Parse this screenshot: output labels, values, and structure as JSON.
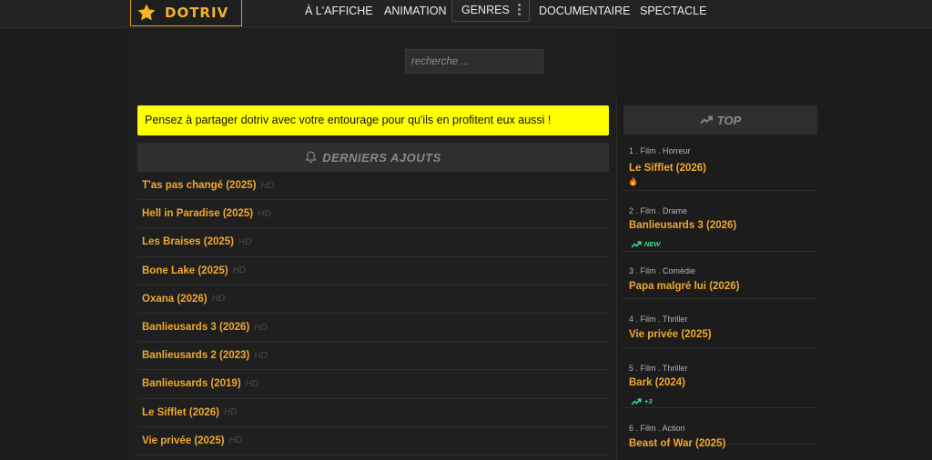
{
  "brand": {
    "name": "DOTRIV"
  },
  "nav": {
    "items": [
      "À L'AFFICHE",
      "ANIMATION",
      "DOCUMENTAIRE",
      "SPECTACLE"
    ],
    "genres_label": "GENRES"
  },
  "search": {
    "placeholder": "recherche ..."
  },
  "notice": {
    "text": "Pensez à partager dotriv avec votre entourage pour qu'ils en profitent eux aussi !"
  },
  "latest": {
    "header": "DERNIERS AJOUTS",
    "hd_label": "HD",
    "items": [
      "T'as pas changé (2025)",
      "Hell in Paradise (2025)",
      "Les Braises (2025)",
      "Bone Lake (2025)",
      "Oxana (2026)",
      "Banlieusards 3 (2026)",
      "Banlieusards 2 (2023)",
      "Banlieusards (2019)",
      "Le Sifflet (2026)",
      "Vie privée (2025)"
    ]
  },
  "top": {
    "header": "TOP",
    "items": [
      {
        "meta": "1 . Film . Horreur",
        "title": "Le Sifflet (2026)",
        "badge_type": "fire",
        "badge": ""
      },
      {
        "meta": "2 . Film . Drame",
        "title": "Banlieusards 3 (2026)",
        "badge_type": "trend",
        "badge": "NEW"
      },
      {
        "meta": "3 . Film . Comédie",
        "title": "Papa malgré lui (2026)",
        "badge_type": "none",
        "badge": ""
      },
      {
        "meta": "4 . Film . Thriller",
        "title": "Vie privée (2025)",
        "badge_type": "none",
        "badge": ""
      },
      {
        "meta": "5 . Film . Thriller",
        "title": "Bark (2024)",
        "badge_type": "trend",
        "badge": "+3"
      },
      {
        "meta": "6 . Film . Action",
        "title": "Beast of War (2025)",
        "badge_type": "none",
        "badge": ""
      }
    ]
  },
  "colors": {
    "accent": "#f0a830",
    "notice_bg": "#ffff00",
    "trend_green": "#3ddc84",
    "background": "#1c1c1c"
  },
  "icons": {
    "logo": "star-icon",
    "genres_menu": "kebab-menu-icon",
    "latest_header": "bell-icon",
    "top_header": "trending-up-icon",
    "fire": "fire-icon"
  }
}
